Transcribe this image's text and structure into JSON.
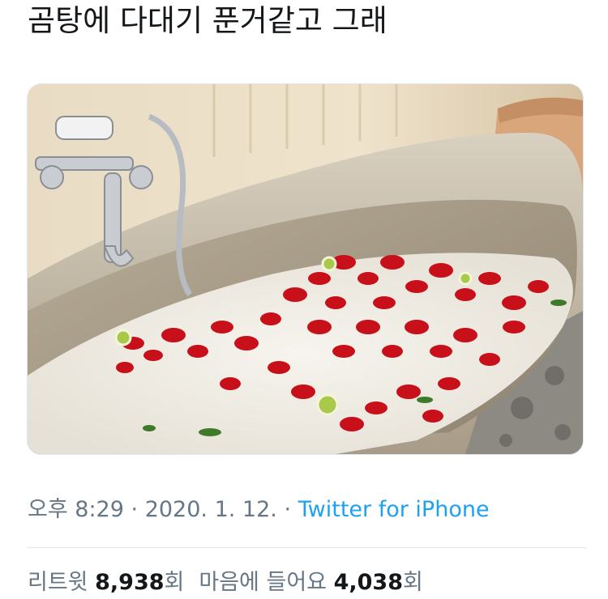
{
  "tweet": {
    "text": "곰탕에 다대기 푼거같고 그래",
    "media": {
      "icon": "photo-bathtub-rose-petals"
    }
  },
  "meta": {
    "time": "오후 8:29",
    "separator": "·",
    "date": "2020. 1. 12.",
    "source": "Twitter for iPhone"
  },
  "stats": {
    "retweets_label": "리트윗",
    "retweets_count": "8,938",
    "retweets_suffix": "회",
    "likes_label": "마음에 들어요",
    "likes_count": "4,038",
    "likes_suffix": "회"
  },
  "colors": {
    "text": "#14171a",
    "secondary": "#657786",
    "link": "#1da1f2",
    "divider": "#e1e8ed"
  }
}
